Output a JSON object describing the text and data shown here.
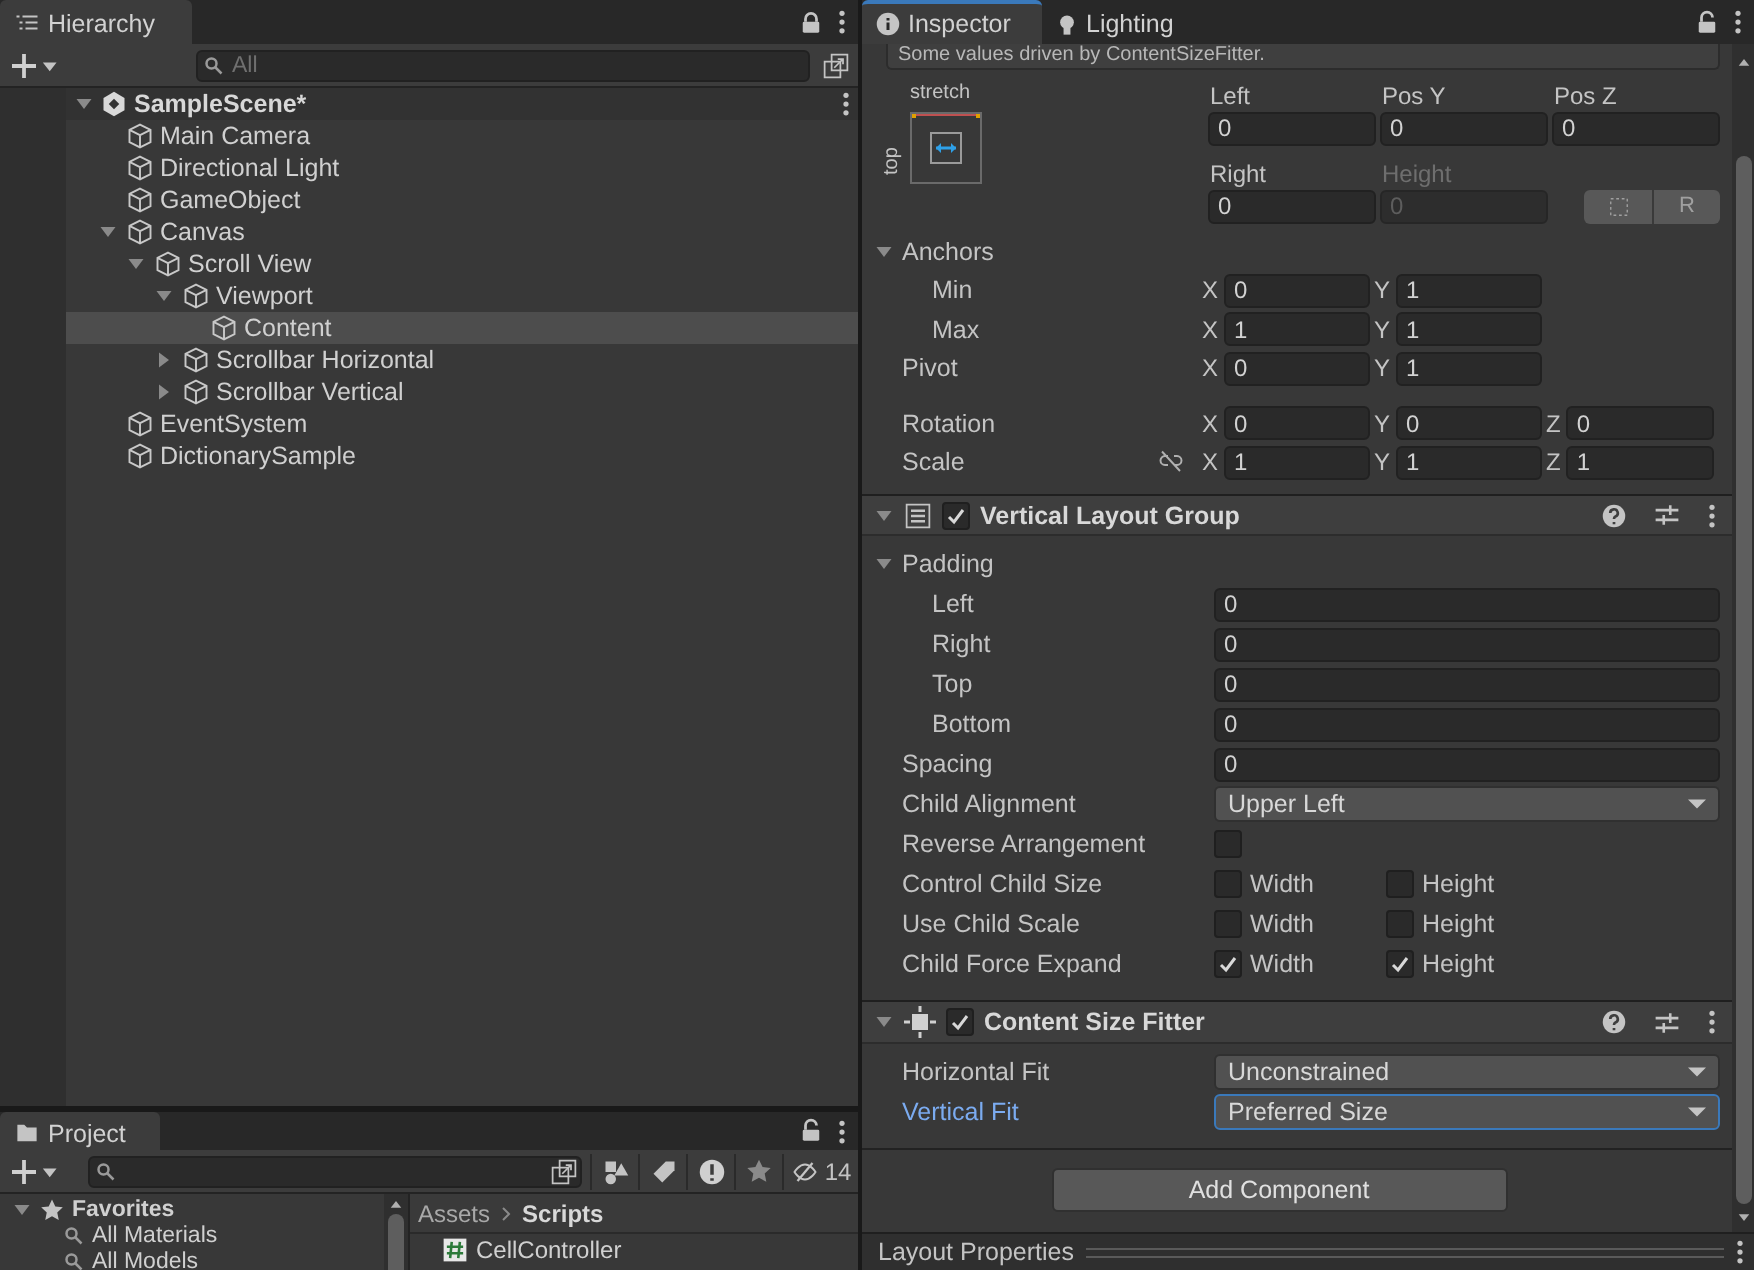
{
  "hierarchy": {
    "tab": "Hierarchy",
    "search": {
      "placeholder": "All"
    },
    "scene": {
      "name": "SampleScene*",
      "expanded": true
    },
    "items": [
      {
        "name": "Main Camera",
        "selected": false
      },
      {
        "name": "Directional Light",
        "selected": false
      },
      {
        "name": "GameObject",
        "selected": false
      },
      {
        "name": "Canvas",
        "selected": false,
        "expanded": true,
        "children": [
          {
            "name": "Scroll View",
            "selected": false,
            "expanded": true,
            "children": [
              {
                "name": "Viewport",
                "selected": false,
                "expanded": true,
                "children": [
                  {
                    "name": "Content",
                    "selected": true
                  }
                ]
              },
              {
                "name": "Scrollbar Horizontal",
                "selected": false,
                "expanded": false
              },
              {
                "name": "Scrollbar Vertical",
                "selected": false,
                "expanded": false
              }
            ]
          }
        ]
      },
      {
        "name": "EventSystem",
        "selected": false
      },
      {
        "name": "DictionarySample",
        "selected": false
      }
    ]
  },
  "project": {
    "tab": "Project",
    "hidden_count": "14",
    "favorites": {
      "label": "Favorites",
      "expanded": true,
      "items": [
        "All Materials",
        "All Models"
      ]
    },
    "breadcrumb": [
      {
        "label": "Assets",
        "current": false
      },
      {
        "label": "Scripts",
        "current": true
      }
    ],
    "files": [
      {
        "name": "CellController",
        "kind": "script"
      }
    ]
  },
  "inspector": {
    "tabs": [
      {
        "label": "Inspector",
        "selected": true
      },
      {
        "label": "Lighting",
        "selected": false
      }
    ],
    "notice": "Some values driven by ContentSizeFitter.",
    "rect_transform": {
      "anchor_preset": {
        "horizontal": "stretch",
        "vertical": "top"
      },
      "position": [
        {
          "label": "Left",
          "value": "0",
          "disabled": false
        },
        {
          "label": "Pos Y",
          "value": "0",
          "disabled": false
        },
        {
          "label": "Pos Z",
          "value": "0",
          "disabled": false
        },
        {
          "label": "Right",
          "value": "0",
          "disabled": false
        },
        {
          "label": "Height",
          "value": "0",
          "disabled": true
        }
      ],
      "raw_edit_label": "R",
      "anchors": {
        "label": "Anchors",
        "expanded": true,
        "rows": [
          {
            "label": "Min",
            "fields": [
              {
                "axis": "X",
                "value": "0"
              },
              {
                "axis": "Y",
                "value": "1"
              }
            ]
          },
          {
            "label": "Max",
            "fields": [
              {
                "axis": "X",
                "value": "1"
              },
              {
                "axis": "Y",
                "value": "1"
              }
            ]
          }
        ]
      },
      "pivot": {
        "label": "Pivot",
        "fields": [
          {
            "axis": "X",
            "value": "0"
          },
          {
            "axis": "Y",
            "value": "1"
          }
        ]
      },
      "rotation": {
        "label": "Rotation",
        "fields": [
          {
            "axis": "X",
            "value": "0"
          },
          {
            "axis": "Y",
            "value": "0"
          },
          {
            "axis": "Z",
            "value": "0"
          }
        ]
      },
      "scale": {
        "label": "Scale",
        "fields": [
          {
            "axis": "X",
            "value": "1"
          },
          {
            "axis": "Y",
            "value": "1"
          },
          {
            "axis": "Z",
            "value": "1"
          }
        ]
      }
    },
    "components": [
      {
        "kind": "vertical_layout_group",
        "title": "Vertical Layout Group",
        "enabled": true,
        "expanded": true,
        "properties": [
          {
            "kind": "foldout",
            "label": "Padding",
            "expanded": true,
            "children": [
              {
                "kind": "number",
                "label": "Left",
                "value": "0"
              },
              {
                "kind": "number",
                "label": "Right",
                "value": "0"
              },
              {
                "kind": "number",
                "label": "Top",
                "value": "0"
              },
              {
                "kind": "number",
                "label": "Bottom",
                "value": "0"
              }
            ]
          },
          {
            "kind": "number",
            "label": "Spacing",
            "value": "0"
          },
          {
            "kind": "dropdown",
            "label": "Child Alignment",
            "value": "Upper Left",
            "focused": false
          },
          {
            "kind": "checkbox",
            "label": "Reverse Arrangement",
            "checked": false
          },
          {
            "kind": "pair",
            "label": "Control Child Size",
            "options": [
              {
                "label": "Width",
                "checked": false
              },
              {
                "label": "Height",
                "checked": false
              }
            ]
          },
          {
            "kind": "pair",
            "label": "Use Child Scale",
            "options": [
              {
                "label": "Width",
                "checked": false
              },
              {
                "label": "Height",
                "checked": false
              }
            ]
          },
          {
            "kind": "pair",
            "label": "Child Force Expand",
            "options": [
              {
                "label": "Width",
                "checked": true
              },
              {
                "label": "Height",
                "checked": true
              }
            ]
          }
        ]
      },
      {
        "kind": "content_size_fitter",
        "title": "Content Size Fitter",
        "enabled": true,
        "expanded": true,
        "properties": [
          {
            "kind": "dropdown",
            "label": "Horizontal Fit",
            "value": "Unconstrained",
            "focused": false
          },
          {
            "kind": "dropdown",
            "label": "Vertical Fit",
            "value": "Preferred Size",
            "focused": true
          }
        ]
      }
    ],
    "add_component": "Add Component",
    "layout_properties": "Layout Properties"
  }
}
